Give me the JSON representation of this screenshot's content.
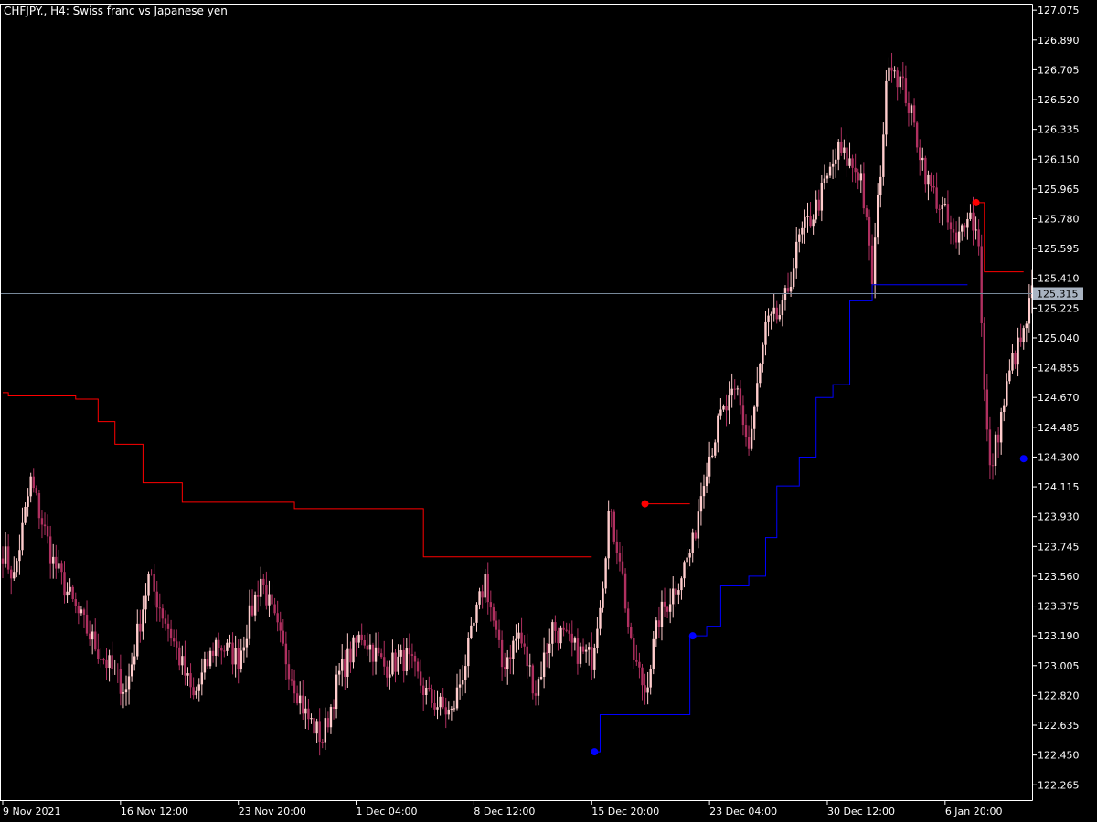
{
  "header": {
    "symbol": "CHFJPY.",
    "timeframe": "H4",
    "description": "Swiss franc vs Japanese yen",
    "title": "CHFJPY., H4:  Swiss franc vs Japanese yen"
  },
  "colors": {
    "background": "#000000",
    "frame": "#ffffff",
    "candle_bull": "#ffcccc",
    "candle_bear": "#b03060",
    "resistance_line": "#ff0000",
    "support_line": "#0000ff",
    "bid_line": "#778899",
    "price_badge": "#a9b4c2"
  },
  "current_price": {
    "value": 125.315,
    "label": "125.315"
  },
  "chart_data": {
    "type": "candlestick",
    "title": "CHFJPY., H4:  Swiss franc vs Japanese yen",
    "y_ticks": [
      "127.075",
      "126.890",
      "126.705",
      "126.520",
      "126.335",
      "126.150",
      "125.965",
      "125.780",
      "125.595",
      "125.410",
      "125.225",
      "125.040",
      "124.855",
      "124.670",
      "124.485",
      "124.300",
      "124.115",
      "123.930",
      "123.745",
      "123.560",
      "123.375",
      "123.190",
      "123.005",
      "122.820",
      "122.635",
      "122.450",
      "122.265"
    ],
    "x_ticks": [
      "9 Nov 2021",
      "16 Nov 12:00",
      "23 Nov 20:00",
      "1 Dec 04:00",
      "8 Dec 12:00",
      "15 Dec 20:00",
      "23 Dec 04:00",
      "30 Dec 12:00",
      "6 Jan 20:00"
    ],
    "x_tick_bar_index": [
      0,
      42,
      84,
      126,
      168,
      210,
      252,
      294,
      336
    ],
    "ylim": [
      122.17,
      127.11
    ],
    "bar_count": 368,
    "close_anchors": [
      [
        0,
        123.72
      ],
      [
        4,
        123.55
      ],
      [
        10,
        124.15
      ],
      [
        18,
        123.65
      ],
      [
        26,
        123.35
      ],
      [
        34,
        123.1
      ],
      [
        44,
        122.85
      ],
      [
        52,
        123.55
      ],
      [
        60,
        123.2
      ],
      [
        68,
        122.8
      ],
      [
        76,
        123.15
      ],
      [
        84,
        123.05
      ],
      [
        92,
        123.55
      ],
      [
        100,
        123.1
      ],
      [
        108,
        122.7
      ],
      [
        114,
        122.55
      ],
      [
        120,
        122.95
      ],
      [
        128,
        123.2
      ],
      [
        136,
        123.0
      ],
      [
        144,
        123.05
      ],
      [
        152,
        122.8
      ],
      [
        160,
        122.7
      ],
      [
        166,
        123.1
      ],
      [
        172,
        123.55
      ],
      [
        178,
        123.0
      ],
      [
        184,
        123.2
      ],
      [
        190,
        122.85
      ],
      [
        196,
        123.25
      ],
      [
        204,
        123.1
      ],
      [
        210,
        123.05
      ],
      [
        214,
        123.55
      ],
      [
        216,
        123.95
      ],
      [
        220,
        123.7
      ],
      [
        224,
        123.1
      ],
      [
        229,
        122.85
      ],
      [
        234,
        123.3
      ],
      [
        240,
        123.5
      ],
      [
        246,
        123.75
      ],
      [
        250,
        124.2
      ],
      [
        256,
        124.55
      ],
      [
        262,
        124.7
      ],
      [
        266,
        124.35
      ],
      [
        272,
        125.1
      ],
      [
        278,
        125.2
      ],
      [
        284,
        125.65
      ],
      [
        290,
        125.85
      ],
      [
        298,
        126.2
      ],
      [
        306,
        126.05
      ],
      [
        310,
        125.4
      ],
      [
        316,
        126.8
      ],
      [
        322,
        126.55
      ],
      [
        330,
        126.0
      ],
      [
        336,
        125.8
      ],
      [
        340,
        125.6
      ],
      [
        344,
        125.85
      ],
      [
        348,
        125.65
      ],
      [
        350,
        124.7
      ],
      [
        352,
        124.2
      ],
      [
        356,
        124.55
      ],
      [
        360,
        124.9
      ],
      [
        364,
        125.05
      ],
      [
        367,
        125.32
      ]
    ],
    "levels": {
      "resistance": [
        [
          0,
          124.7
        ],
        [
          2,
          124.68
        ],
        [
          26,
          124.66
        ],
        [
          34,
          124.52
        ],
        [
          40,
          124.38
        ],
        [
          50,
          124.14
        ],
        [
          64,
          124.02
        ],
        [
          104,
          123.98
        ],
        [
          150,
          123.68
        ],
        [
          210,
          123.68
        ]
      ],
      "resistance_segment_2": [
        [
          229,
          124.01
        ],
        [
          245,
          124.01
        ]
      ],
      "resistance_segment_3": [
        [
          347,
          125.88
        ],
        [
          350,
          125.45
        ],
        [
          364,
          125.45
        ]
      ],
      "support": [
        [
          211,
          122.47
        ],
        [
          213,
          122.7
        ],
        [
          226,
          122.7
        ],
        [
          245,
          123.19
        ],
        [
          251,
          123.25
        ],
        [
          256,
          123.5
        ],
        [
          266,
          123.56
        ],
        [
          272,
          123.8
        ],
        [
          276,
          124.12
        ],
        [
          284,
          124.3
        ],
        [
          290,
          124.67
        ],
        [
          296,
          124.75
        ],
        [
          302,
          125.27
        ],
        [
          310,
          125.37
        ],
        [
          320,
          125.37
        ],
        [
          344,
          125.37
        ]
      ]
    },
    "markers": [
      {
        "type": "resistance",
        "bar": 229,
        "price": 124.01
      },
      {
        "type": "support",
        "bar": 211,
        "price": 122.47
      },
      {
        "type": "support",
        "bar": 246,
        "price": 123.19
      },
      {
        "type": "resistance",
        "bar": 347,
        "price": 125.88
      },
      {
        "type": "support",
        "bar": 364,
        "price": 124.29
      }
    ]
  }
}
